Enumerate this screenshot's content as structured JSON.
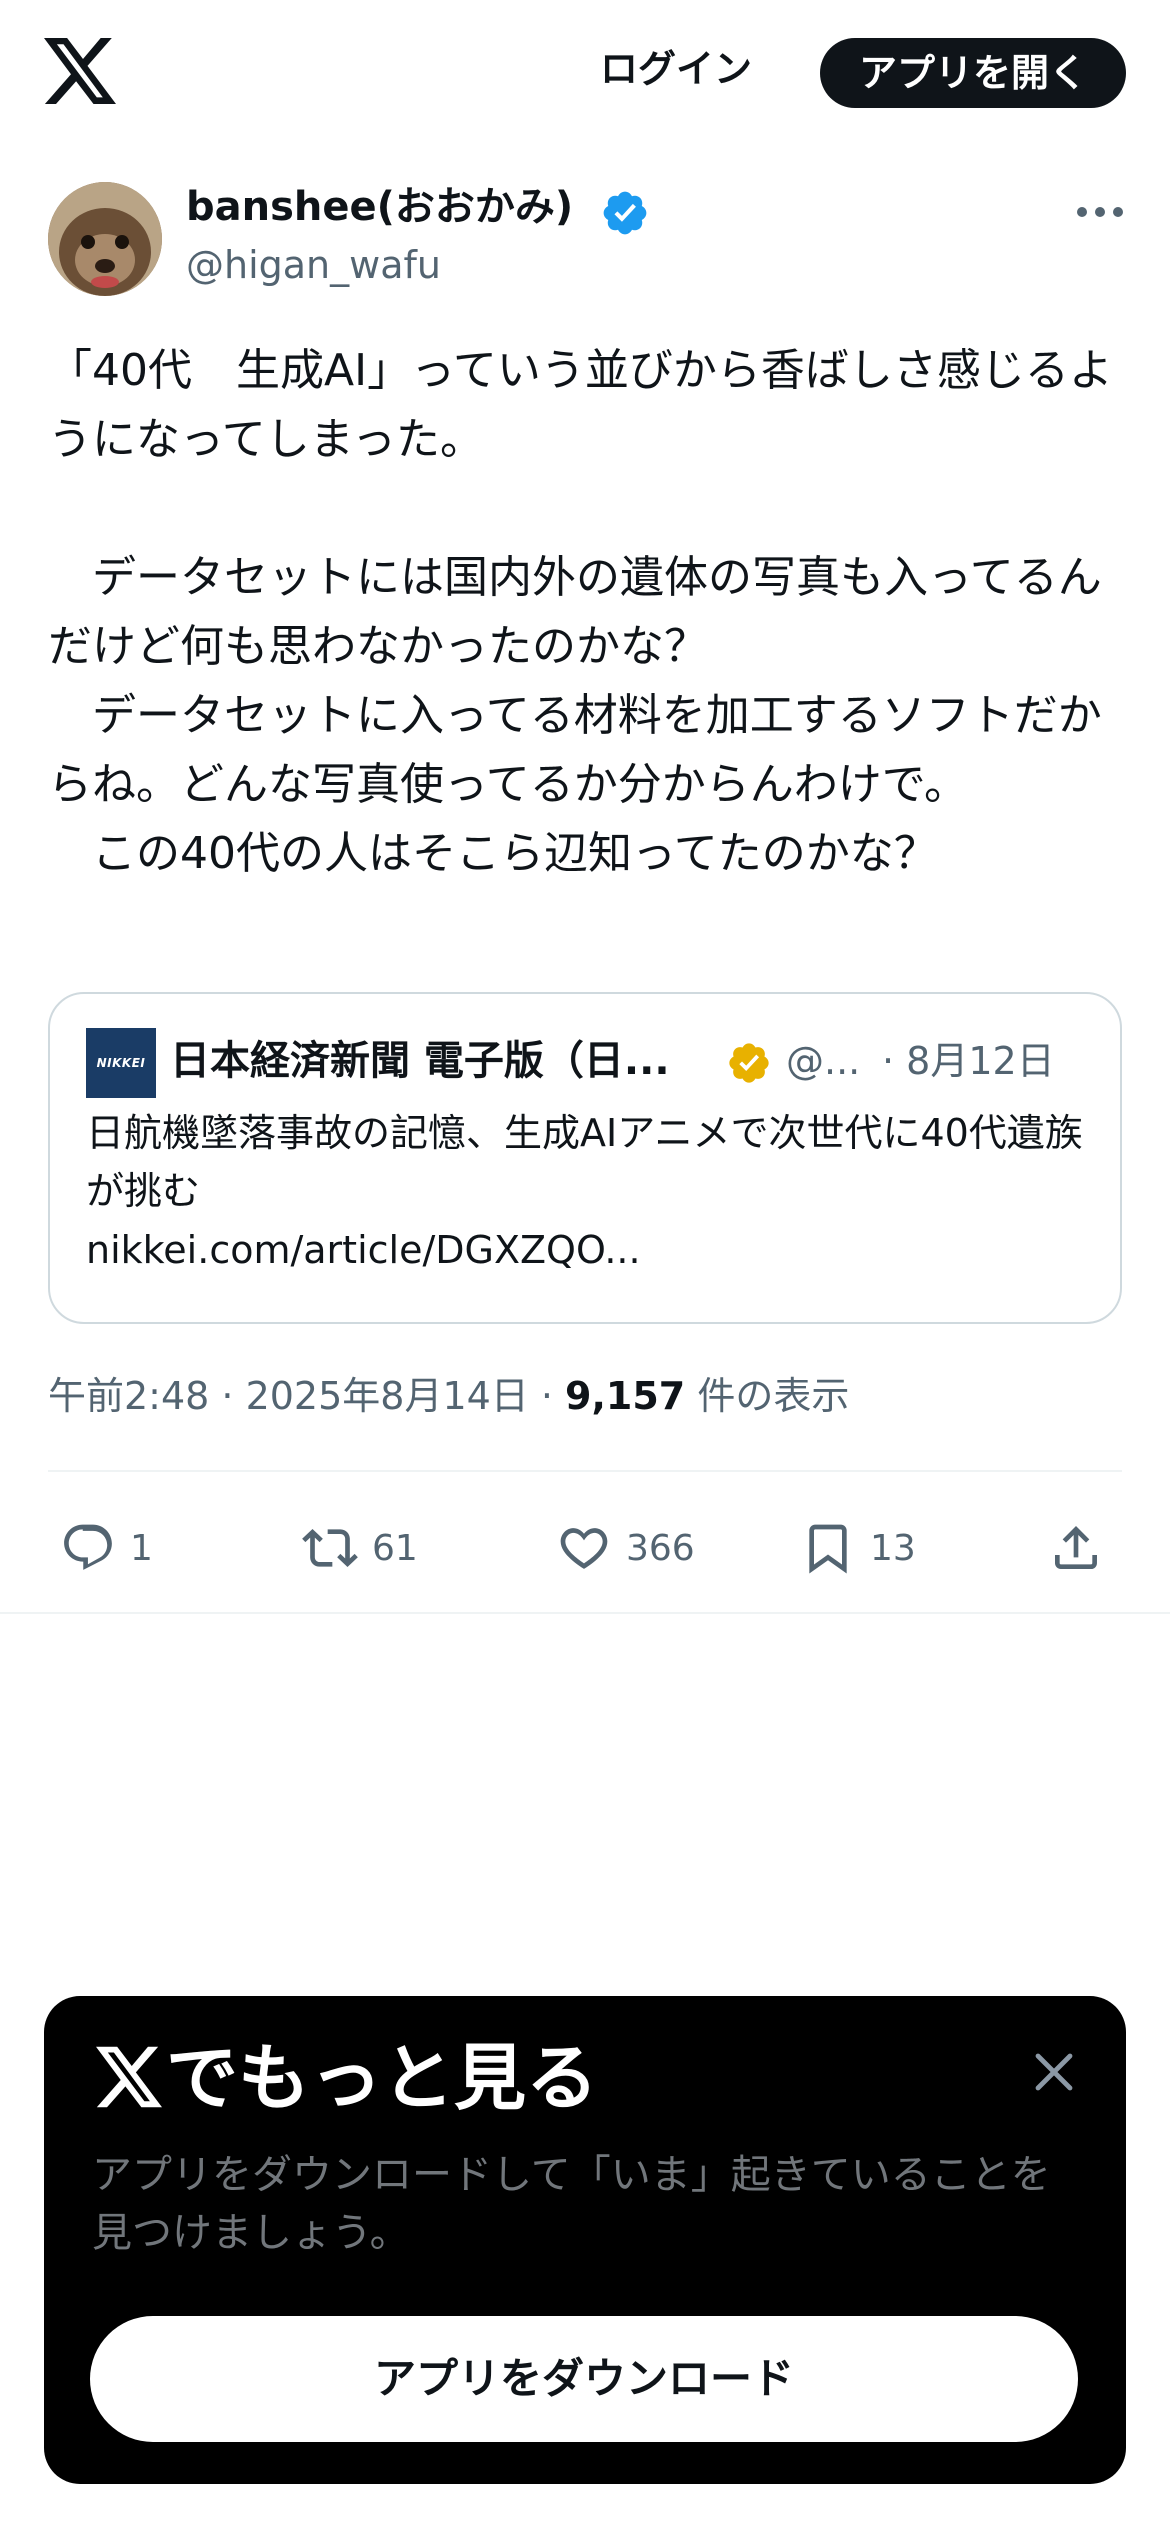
{
  "header": {
    "logo_icon": "x-logo-icon",
    "login_label": "ログイン",
    "open_app_label": "アプリを開く"
  },
  "post": {
    "author": {
      "display_name": "banshee(おおかみ)",
      "handle": "@higan_wafu",
      "verified_color": "#1d9bf0"
    },
    "text": "「40代　生成AI」っていう並びから香ばしさ感じるようになってしまった。\n\n　データセットには国内外の遺体の写真も入ってるんだけど何も思わなかったのかな？\n　データセットに入ってる材料を加工するソフトだからね。どんな写真使ってるか分からんわけで。\n　この40代の人はそこら辺知ってたのかな？",
    "quote": {
      "logo_text": "NIKKEI",
      "name": "日本経済新聞 電子版（日...",
      "handle": "@...",
      "date": "· 8月12日",
      "verified_color": "#e8b100",
      "text": "日航機墜落事故の記憶、生成AIアニメで次世代に40代遺族が挑む",
      "link": "nikkei.com/article/DGXZQO..."
    },
    "meta": {
      "time_date": "午前2:48 · 2025年8月14日 · ",
      "views_count": "9,157",
      "views_label": " 件の表示"
    },
    "actions": {
      "replies": "1",
      "reposts": "61",
      "likes": "366",
      "bookmarks": "13"
    }
  },
  "sheet": {
    "title": "でもっと見る",
    "description": "アプリをダウンロードして「いま」起きていることを見つけましょう。",
    "button_label": "アプリをダウンロード"
  }
}
